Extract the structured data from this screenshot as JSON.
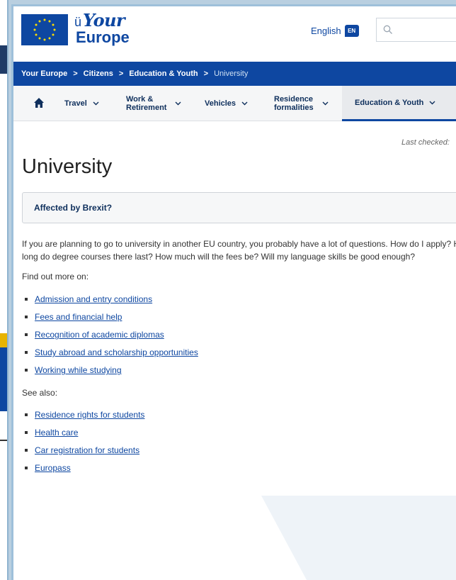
{
  "header": {
    "logo_your": "Your",
    "logo_europe": "Europe",
    "language_label": "English",
    "language_code": "EN",
    "search_placeholder": ""
  },
  "breadcrumb": {
    "items": [
      "Your Europe",
      "Citizens",
      "Education & Youth"
    ],
    "current": "University",
    "separator": ">"
  },
  "nav": {
    "items": [
      {
        "label": "Travel"
      },
      {
        "label_line1": "Work &",
        "label_line2": "Retirement"
      },
      {
        "label": "Vehicles"
      },
      {
        "label_line1": "Residence",
        "label_line2": "formalities"
      },
      {
        "label": "Education & Youth",
        "active": true
      }
    ]
  },
  "page": {
    "last_checked": "Last checked: ",
    "title": "University",
    "brexit_box": "Affected by Brexit?",
    "intro_line1": "If you are planning to go to university in another EU country, you probably have a lot of questions. How do I apply? How",
    "intro_line2": "long do degree courses there last? How much will the fees be? Will my language skills be good enough?",
    "find_out_more": "Find out more on:",
    "find_out_links": [
      "Admission and entry conditions",
      "Fees and financial help",
      "Recognition of academic diplomas",
      "Study abroad and scholarship opportunities",
      "Working while studying"
    ],
    "see_also": "See also:",
    "see_also_links": [
      "Residence rights for students",
      "Health care",
      "Car registration for students",
      "Europass"
    ]
  },
  "colors": {
    "brand_blue": "#0e47a1",
    "link": "#0e47a1",
    "frame": "#9ec0da"
  }
}
